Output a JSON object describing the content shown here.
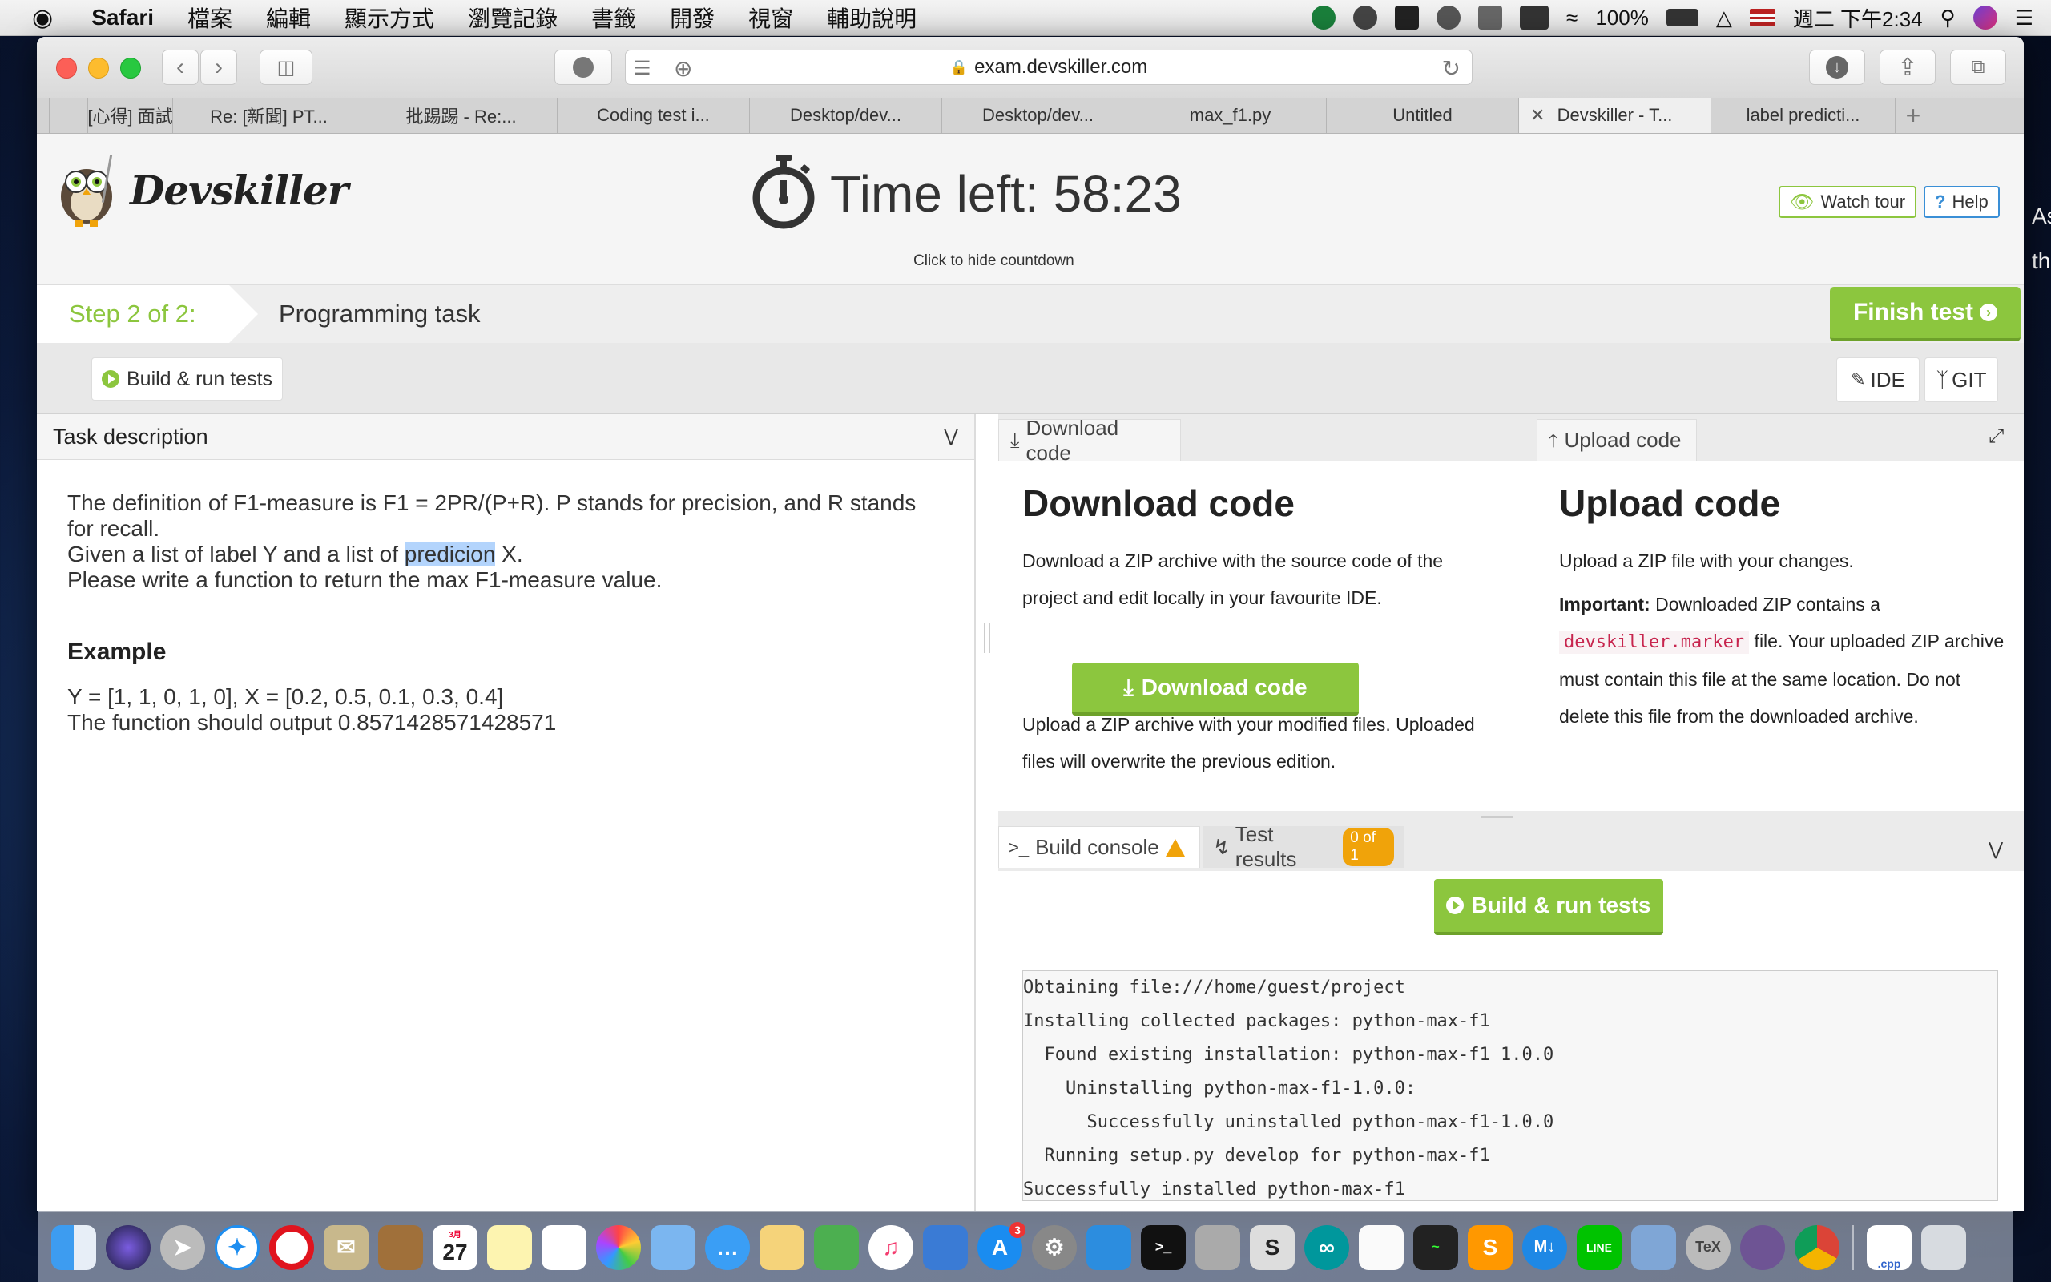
{
  "menubar": {
    "apple": "",
    "app": "Safari",
    "items": [
      "檔案",
      "編輯",
      "顯示方式",
      "瀏覽記錄",
      "書籤",
      "開發",
      "視窗",
      "輔助說明"
    ],
    "battery": "100%",
    "clock": "週二 下午2:34"
  },
  "browser": {
    "url": "exam.devskiller.com",
    "tabs": [
      {
        "label": "",
        "active": false
      },
      {
        "label": "[心得] 面試",
        "active": false
      },
      {
        "label": "Re: [新聞] PT...",
        "active": false
      },
      {
        "label": "批踢踢 - Re:...",
        "active": false
      },
      {
        "label": "Coding test i...",
        "active": false
      },
      {
        "label": "Desktop/dev...",
        "active": false
      },
      {
        "label": "Desktop/dev...",
        "active": false
      },
      {
        "label": "max_f1.py",
        "active": false
      },
      {
        "label": "Untitled",
        "active": false
      },
      {
        "label": "Devskiller - T...",
        "active": true
      },
      {
        "label": "label predicti...",
        "active": false
      }
    ]
  },
  "header": {
    "logo": "Devskiller",
    "timer_label": "Time left:",
    "timer_value": "58:23",
    "timer_hint": "Click to hide countdown",
    "watch_tour": "Watch tour",
    "help": "Help"
  },
  "steps": {
    "current": "Step 2 of 2:",
    "task": "Programming task",
    "finish": "Finish test"
  },
  "actions": {
    "build_run": "Build & run tests",
    "ide": "IDE",
    "git": "GIT"
  },
  "task": {
    "heading": "Task description",
    "line1": "The definition of F1-measure is F1 = 2PR/(P+R). P stands for precision, and R stands for recall.",
    "line2a": "Given a list of label Y and a list of ",
    "line2_highlight": "predicion",
    "line2b": " X.",
    "line3": "Please write a function to return the max F1-measure value.",
    "example_heading": "Example",
    "example1": "Y = [1, 1, 0, 1, 0], X = [0.2, 0.5, 0.1, 0.3, 0.4]",
    "example2": "The function should output 0.8571428571428571"
  },
  "code": {
    "tab_download": "Download code",
    "tab_upload": "Upload code",
    "download_title": "Download code",
    "download_text": "Download a ZIP archive with the source code of the project and edit locally in your favourite IDE.",
    "download_button": "Download code",
    "upload_note": "Upload a ZIP archive with your modified files. Uploaded files will overwrite the previous edition.",
    "upload_title": "Upload code",
    "upload_text": "Upload a ZIP file with your changes.",
    "important_label": "Important:",
    "important_a": " Downloaded ZIP contains a ",
    "marker_file": "devskiller.marker",
    "important_b": " file. Your uploaded ZIP archive must contain this file at the same location. Do not delete this file from the downloaded archive."
  },
  "console": {
    "tab_build": "Build console",
    "tab_tests": "Test results",
    "tests_badge": "0 of 1",
    "build_button": "Build & run tests",
    "lines": [
      "Obtaining file:///home/guest/project",
      "Installing collected packages: python-max-f1",
      "  Found existing installation: python-max-f1 1.0.0",
      "    Uninstalling python-max-f1-1.0.0:",
      "      Successfully uninstalled python-max-f1-1.0.0",
      "  Running setup.py develop for python-max-f1",
      "Successfully installed python-max-f1"
    ]
  },
  "edge": {
    "line1": "As",
    "line2": "th"
  },
  "dock": {
    "calendar_day": "27",
    "calendar_month": "3月",
    "appstore_badge": "3",
    "file_label": ".cpp"
  },
  "colors": {
    "accent_green": "#8cc63e",
    "link_blue": "#3a8fd6",
    "warning": "#f0a30a"
  }
}
